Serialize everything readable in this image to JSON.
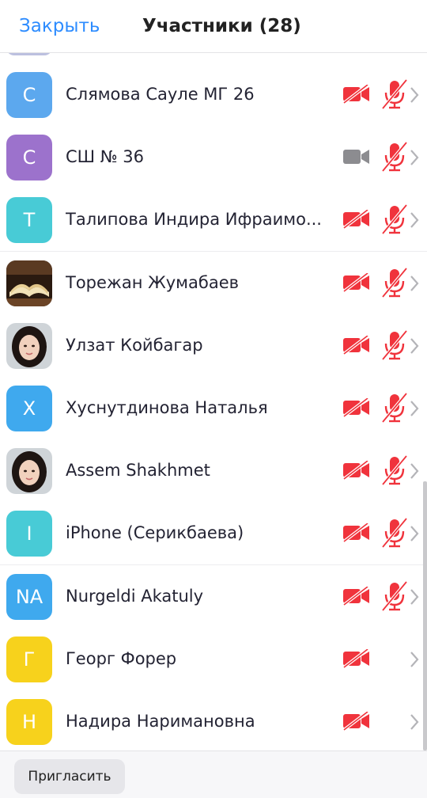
{
  "header": {
    "close_label": "Закрыть",
    "title": "Участники (28)"
  },
  "colors": {
    "accent": "#2d8cff",
    "muted_red": "#f0333c",
    "video_on_gray": "#8c8c90"
  },
  "participants": [
    {
      "name": "Слямова Сауле МГ 26",
      "avatar": {
        "type": "letter",
        "text": "С",
        "color": "#5ca8ee"
      },
      "video": "off",
      "audio": "muted"
    },
    {
      "name": "СШ № 36",
      "avatar": {
        "type": "letter",
        "text": "С",
        "color": "#9c72cc"
      },
      "video": "on",
      "audio": "muted"
    },
    {
      "name": "Талипова Индира Ифраимо...",
      "avatar": {
        "type": "letter",
        "text": "Т",
        "color": "#48cbd6"
      },
      "video": "off",
      "audio": "muted"
    },
    {
      "name": "Торежан Жумабаев",
      "avatar": {
        "type": "photo",
        "icon": "open-book-photo"
      },
      "video": "off",
      "audio": "muted"
    },
    {
      "name": "Улзат Койбагар",
      "avatar": {
        "type": "photo",
        "icon": "person-photo"
      },
      "video": "off",
      "audio": "muted"
    },
    {
      "name": "Хуснутдинова Наталья",
      "avatar": {
        "type": "letter",
        "text": "Х",
        "color": "#3fa9ee"
      },
      "video": "off",
      "audio": "muted"
    },
    {
      "name": "Assem Shakhmet",
      "avatar": {
        "type": "photo",
        "icon": "person-photo"
      },
      "video": "off",
      "audio": "muted"
    },
    {
      "name": "iPhone (Серикбаева)",
      "avatar": {
        "type": "letter",
        "text": "I",
        "color": "#48cbd6"
      },
      "video": "off",
      "audio": "muted"
    },
    {
      "name": "Nurgeldi Akatuly",
      "avatar": {
        "type": "letter",
        "text": "NA",
        "color": "#3fa9ee"
      },
      "video": "off",
      "audio": "muted"
    },
    {
      "name": "Георг Форер",
      "avatar": {
        "type": "letter",
        "text": "Г",
        "color": "#f7d21c"
      },
      "video": "off",
      "audio": "none"
    },
    {
      "name": "Надира Наримановна",
      "avatar": {
        "type": "letter",
        "text": "Н",
        "color": "#f7d21c"
      },
      "video": "off",
      "audio": "none"
    }
  ],
  "footer": {
    "invite_label": "Пригласить"
  }
}
